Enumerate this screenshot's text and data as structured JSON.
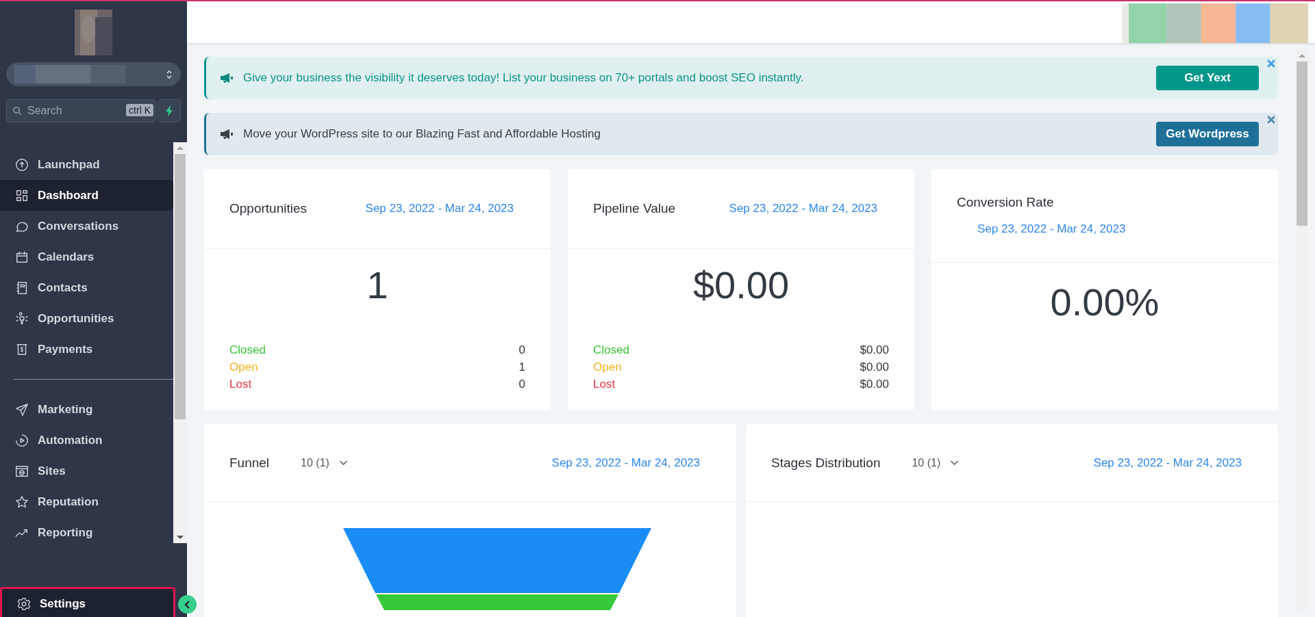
{
  "sidebar": {
    "search": {
      "placeholder": "Search",
      "shortcut": "ctrl K"
    },
    "nav_groups": [
      [
        {
          "label": "Launchpad",
          "selected": false
        },
        {
          "label": "Dashboard",
          "selected": true
        },
        {
          "label": "Conversations",
          "selected": false
        },
        {
          "label": "Calendars",
          "selected": false
        },
        {
          "label": "Contacts",
          "selected": false
        },
        {
          "label": "Opportunities",
          "selected": false
        },
        {
          "label": "Payments",
          "selected": false
        }
      ],
      [
        {
          "label": "Marketing",
          "selected": false
        },
        {
          "label": "Automation",
          "selected": false
        },
        {
          "label": "Sites",
          "selected": false
        },
        {
          "label": "Reputation",
          "selected": false
        },
        {
          "label": "Reporting",
          "selected": false
        }
      ]
    ],
    "settings": {
      "label": "Settings",
      "highlighted": true
    }
  },
  "banners": [
    {
      "kind": "teal",
      "text": "Give your business the visibility it deserves today! List your business on 70+ portals and boost SEO instantly.",
      "button": "Get Yext"
    },
    {
      "kind": "blue",
      "text": "Move your WordPress site to our Blazing Fast and Affordable Hosting",
      "button": "Get Wordpress"
    }
  ],
  "stat_cards": [
    {
      "title": "Opportunities",
      "date_range": "Sep 23, 2022 - Mar 24, 2023",
      "value": "1",
      "rows": [
        {
          "kind": "closed",
          "label": "Closed",
          "value": "0"
        },
        {
          "kind": "open",
          "label": "Open",
          "value": "1"
        },
        {
          "kind": "lost",
          "label": "Lost",
          "value": "0"
        }
      ]
    },
    {
      "title": "Pipeline Value",
      "date_range": "Sep 23, 2022 - Mar 24, 2023",
      "value": "$0.00",
      "rows": [
        {
          "kind": "closed",
          "label": "Closed",
          "value": "$0.00"
        },
        {
          "kind": "open",
          "label": "Open",
          "value": "$0.00"
        },
        {
          "kind": "lost",
          "label": "Lost",
          "value": "$0.00"
        }
      ]
    },
    {
      "title": "Conversion Rate",
      "date_range": "Sep 23, 2022 - Mar 24, 2023",
      "value": "0.00%"
    }
  ],
  "chart_cards": [
    {
      "title": "Funnel",
      "pipeline": "10 (1)",
      "date_range": "Sep 23, 2022 - Mar 24, 2023",
      "kind": "funnel"
    },
    {
      "title": "Stages Distribution",
      "pipeline": "10 (1)",
      "date_range": "Sep 23, 2022 - Mar 24, 2023",
      "kind": "empty"
    }
  ]
}
